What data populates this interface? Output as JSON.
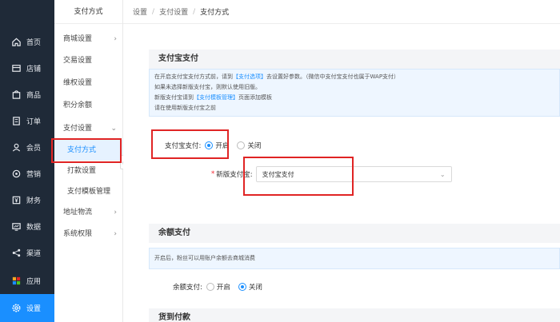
{
  "nav": {
    "items": [
      {
        "label": "首页",
        "icon": "home-icon"
      },
      {
        "label": "店铺",
        "icon": "store-icon"
      },
      {
        "label": "商品",
        "icon": "goods-icon"
      },
      {
        "label": "订单",
        "icon": "order-icon"
      },
      {
        "label": "会员",
        "icon": "member-icon"
      },
      {
        "label": "营销",
        "icon": "marketing-icon"
      },
      {
        "label": "财务",
        "icon": "finance-icon"
      },
      {
        "label": "数据",
        "icon": "data-icon"
      },
      {
        "label": "渠道",
        "icon": "channel-icon"
      },
      {
        "label": "应用",
        "icon": "apps-icon"
      },
      {
        "label": "设置",
        "icon": "settings-icon"
      }
    ]
  },
  "subnav": {
    "title": "支付方式",
    "items": [
      {
        "label": "商城设置"
      },
      {
        "label": "交易设置"
      },
      {
        "label": "维权设置"
      },
      {
        "label": "积分余额"
      },
      {
        "label": "支付设置"
      },
      {
        "label": "支付方式"
      },
      {
        "label": "打款设置"
      },
      {
        "label": "支付模板管理"
      },
      {
        "label": "地址物流"
      },
      {
        "label": "系统权限"
      }
    ]
  },
  "breadcrumb": {
    "items": [
      "设置",
      "支付设置",
      "支付方式"
    ]
  },
  "alipay": {
    "title": "支付宝支付",
    "info_line1_a": "在开启支付宝支付方式前，请到",
    "info_line1_link": "【支付选项】",
    "info_line1_b": "去设置好参数。（微信中支付宝支付也属于WAP支付）",
    "info_line2": "如果未选择新版支付宝，则默认使用旧版。",
    "info_line3_a": "新版支付宝请到",
    "info_line3_link": "【支付模板管理】",
    "info_line3_b": "页面添加模板",
    "info_line4": "请在使用新版支付宝之前",
    "toggle_label": "支付宝支付:",
    "on_label": "开启",
    "off_label": "关闭",
    "new_label": "新版支付宝:",
    "new_value": "支付宝支付"
  },
  "balance": {
    "title": "余额支付",
    "info": "开启后，粉丝可以用账户余额去商城消费",
    "toggle_label": "余额支付:",
    "on_label": "开启",
    "off_label": "关闭"
  },
  "cod": {
    "title": "货到付款"
  },
  "colors": {
    "accent": "#1a8fff",
    "nav_bg": "#1f2a38",
    "highlight": "#e02424"
  }
}
